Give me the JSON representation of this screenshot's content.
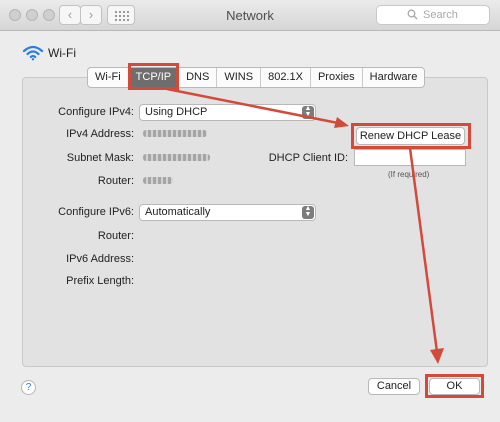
{
  "window": {
    "title": "Network"
  },
  "toolbar": {
    "back_icon": "‹",
    "forward_icon": "›",
    "search_placeholder": "Search"
  },
  "network": {
    "name": "Wi-Fi"
  },
  "tabs": [
    {
      "label": "Wi-Fi"
    },
    {
      "label": "TCP/IP",
      "active": true
    },
    {
      "label": "DNS"
    },
    {
      "label": "WINS"
    },
    {
      "label": "802.1X"
    },
    {
      "label": "Proxies"
    },
    {
      "label": "Hardware"
    }
  ],
  "form": {
    "configure_ipv4_label": "Configure IPv4:",
    "configure_ipv4_value": "Using DHCP",
    "ipv4_address_label": "IPv4 Address:",
    "subnet_mask_label": "Subnet Mask:",
    "router_label": "Router:",
    "renew_button": "Renew DHCP Lease",
    "dhcp_client_id_label": "DHCP Client ID:",
    "dhcp_client_id_value": "",
    "dhcp_client_id_hint": "(If required)",
    "configure_ipv6_label": "Configure IPv6:",
    "configure_ipv6_value": "Automatically",
    "router6_label": "Router:",
    "ipv6_address_label": "IPv6 Address:",
    "prefix_length_label": "Prefix Length:"
  },
  "footer": {
    "help_label": "?",
    "cancel_label": "Cancel",
    "ok_label": "OK"
  },
  "colors": {
    "highlight": "#d24a3a",
    "active_tab": "#6e6e6e"
  }
}
